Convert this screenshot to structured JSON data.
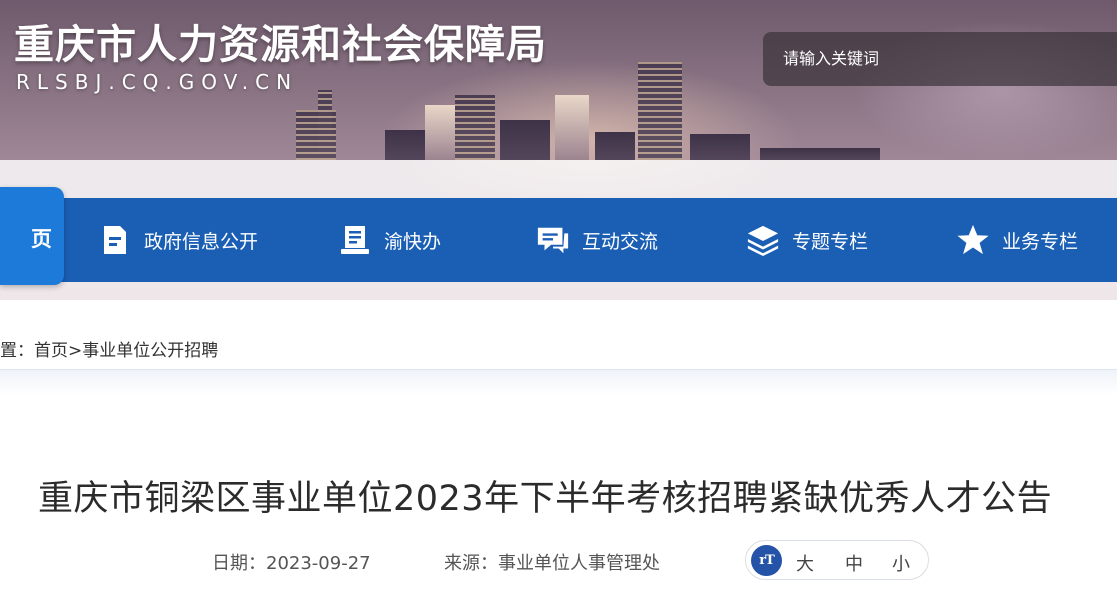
{
  "header": {
    "site_title": "重庆市人力资源和社会保障局",
    "site_domain": "RLSBJ.CQ.GOV.CN",
    "search_placeholder": "请输入关键词"
  },
  "nav": {
    "home_label": "页",
    "items": [
      {
        "label": "政府信息公开",
        "icon": "document-icon"
      },
      {
        "label": "渝快办",
        "icon": "service-desk-icon"
      },
      {
        "label": "互动交流",
        "icon": "chat-icon"
      },
      {
        "label": "专题专栏",
        "icon": "layers-icon"
      },
      {
        "label": "业务专栏",
        "icon": "star-icon"
      }
    ]
  },
  "breadcrumb": {
    "prefix": "置：",
    "home": "首页",
    "separator": ">",
    "current": "事业单位公开招聘"
  },
  "article": {
    "title": "重庆市铜梁区事业单位2023年下半年考核招聘紧缺优秀人才公告",
    "date_label": "日期：",
    "date": "2023-09-27",
    "source_label": "来源：",
    "source": "事业单位人事管理处",
    "font_size": {
      "icon_text": "rT",
      "large": "大",
      "medium": "中",
      "small": "小"
    }
  },
  "colors": {
    "nav_bg": "#1a5fb4",
    "nav_home_bg": "#1e7ad8",
    "font_icon_bg": "#2553a8"
  }
}
